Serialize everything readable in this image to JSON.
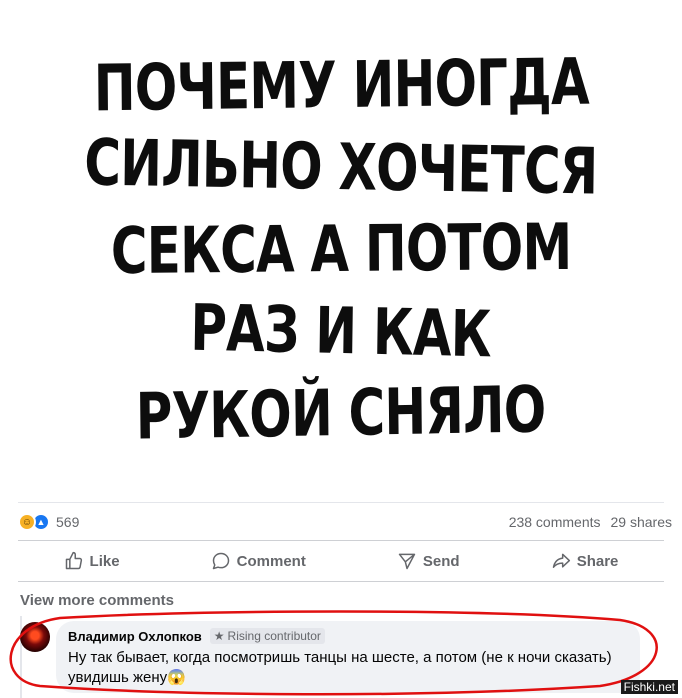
{
  "poster": {
    "lines": [
      "ПОЧЕМУ ИНОГДА",
      "СИЛЬНО ХОЧЕТСЯ",
      "СЕКСА А ПОТОМ",
      "РАЗ И КАК",
      "РУКОЙ СНЯЛО"
    ]
  },
  "stats": {
    "reactions_count": "569",
    "comments": "238 comments",
    "shares": "29 shares",
    "reaction_icons": [
      "haha-icon",
      "like-icon"
    ]
  },
  "actions": {
    "like": "Like",
    "comment": "Comment",
    "send": "Send",
    "share": "Share"
  },
  "comments": {
    "view_more": "View more comments",
    "items": [
      {
        "author": "Владимир Охлопков",
        "badge": "Rising contributor",
        "text": "Ну так бывает, когда посмотришь танцы на шесте, а потом (не к ночи сказать) увидишь жену😱"
      }
    ]
  },
  "watermark": "Fishki.net",
  "colors": {
    "link_blue": "#1877f2",
    "annotation_red": "#e01010",
    "muted_text": "#65676b",
    "bubble_bg": "#f0f2f5"
  }
}
